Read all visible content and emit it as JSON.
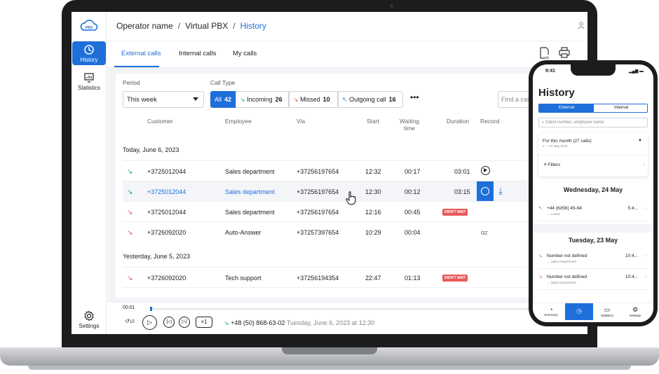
{
  "breadcrumb": {
    "operator": "Operator name",
    "pbx": "Virtual PBX",
    "current": "History"
  },
  "sidebar": {
    "history_label": "History",
    "statistics_label": "Statistics",
    "settings_label": "Settings",
    "logo_text": "PBX"
  },
  "tabs": [
    "External calls",
    "Internal calls",
    "My calls"
  ],
  "filters": {
    "period_label": "Period",
    "period_value": "This week",
    "calltype_label": "Call Type",
    "types": [
      {
        "label": "All",
        "count": "42"
      },
      {
        "label": "Incoming",
        "count": "26"
      },
      {
        "label": "Missed",
        "count": "10"
      },
      {
        "label": "Outgoing call",
        "count": "16"
      }
    ],
    "more": "•••",
    "find_placeholder": "Find a call"
  },
  "columns": [
    "Customer",
    "Employee",
    "Via",
    "Start",
    "Waiting time",
    "Duration",
    "Record"
  ],
  "groups": [
    "Today, June 6, 2023",
    "Yesterday, June 5, 2023"
  ],
  "rows": [
    {
      "customer": "+3725012044",
      "employee": "Sales department",
      "via": "+37256197654",
      "start": "12:32",
      "waiting": "00:17",
      "duration": "03:01"
    },
    {
      "customer": "+3725012044",
      "employee": "Sales department",
      "via": "+37256197654",
      "start": "12:30",
      "waiting": "00:12",
      "duration": "03:15"
    },
    {
      "customer": "+3725012044",
      "employee": "Sales department",
      "via": "+37256197654",
      "start": "12:16",
      "waiting": "00:45",
      "badge": "DIDN'T WAIT"
    },
    {
      "customer": "+3726092020",
      "employee": "Auto-Answer",
      "via": "+37257397654",
      "start": "10:29",
      "waiting": "00:04",
      "record": "αz"
    },
    {
      "customer": "+3726092020",
      "employee": "Tech support",
      "via": "+37256194354",
      "start": "22:47",
      "waiting": "01:13",
      "badge": "DIDN'T WAIT"
    }
  ],
  "player": {
    "elapsed": "00:01",
    "rewind": "15",
    "speed": "×1",
    "number": "+48 (50) 868-63-02",
    "when": "Tuesday, June 6, 2023 at 12:30"
  },
  "phone": {
    "time": "9:41",
    "title": "History",
    "tab_external": "External",
    "tab_internal": "Internal",
    "search_placeholder": "Client number, employee name",
    "period": "For this month (27 calls)",
    "period_range": "1 — 31 May 2023",
    "filters": "Filters",
    "day1": "Wednesday, 24 May",
    "day2": "Tuesday, 23 May",
    "calls": [
      {
        "number": "+44 (6356) 45-64",
        "sub": "← Louise",
        "time": "5:4..."
      },
      {
        "number": "Number not defined",
        "sub": "→ Sales Department",
        "time": "10:4..."
      },
      {
        "number": "Number not defined",
        "sub": "→ Sales Department",
        "time": "10:4..."
      }
    ],
    "nav": [
      "Summary",
      "",
      "Statistics",
      "Settings"
    ]
  },
  "colors": {
    "accent": "#1e6fd9",
    "missed": "#e85a5a",
    "incoming": "#27ae60",
    "outgoing": "#1e88e5"
  }
}
